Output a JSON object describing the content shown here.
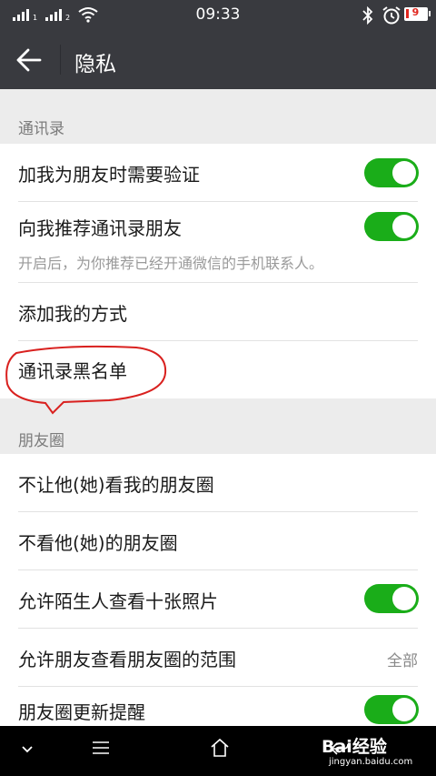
{
  "status": {
    "time": "09:33",
    "battery": "9",
    "sim1_label": "1",
    "sim2_label": "2"
  },
  "header": {
    "title": "隐私"
  },
  "contacts": {
    "section_title": "通讯录",
    "items": [
      {
        "label": "加我为朋友时需要验证",
        "toggle": true
      },
      {
        "label": "向我推荐通讯录朋友",
        "toggle": true,
        "desc": "开启后，为你推荐已经开通微信的手机联系人。"
      },
      {
        "label": "添加我的方式"
      },
      {
        "label": "通讯录黑名单"
      }
    ]
  },
  "moments": {
    "section_title": "朋友圈",
    "items": [
      {
        "label": "不让他(她)看我的朋友圈"
      },
      {
        "label": "不看他(她)的朋友圈"
      },
      {
        "label": "允许陌生人查看十张照片",
        "toggle": true
      },
      {
        "label": "允许朋友查看朋友圈的范围",
        "value": "全部"
      },
      {
        "label": "朋友圈更新提醒",
        "toggle": true
      }
    ]
  },
  "watermark": {
    "brand": "Bai经验",
    "url": "jingyan.baidu.com"
  },
  "colors": {
    "toggle_on": "#1aad19",
    "header_bg": "#393a3f",
    "annotation": "#d9211f"
  }
}
